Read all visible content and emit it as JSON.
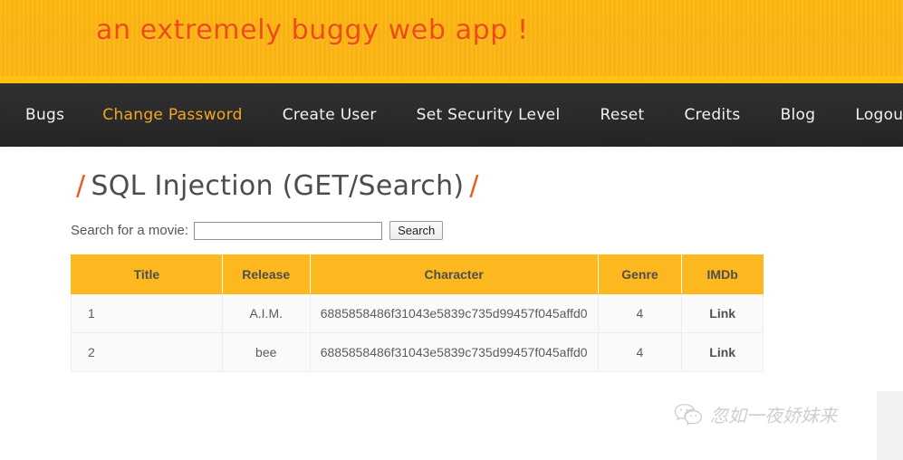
{
  "banner": {
    "tagline": "an extremely buggy web app !",
    "bg_color": "#fcb813",
    "stripe_color": "#ffc20e",
    "tagline_color": "#f04a18"
  },
  "nav": {
    "bg_color": "#2b2b2b",
    "active_color": "#f5a623",
    "items": [
      {
        "label": "Bugs",
        "active": false
      },
      {
        "label": "Change Password",
        "active": true
      },
      {
        "label": "Create User",
        "active": false
      },
      {
        "label": "Set Security Level",
        "active": false
      },
      {
        "label": "Reset",
        "active": false
      },
      {
        "label": "Credits",
        "active": false
      },
      {
        "label": "Blog",
        "active": false
      },
      {
        "label": "Logout",
        "active": false
      }
    ]
  },
  "page": {
    "title": "SQL Injection (GET/Search)",
    "title_slash": "/",
    "title_color": "#4d4d4d"
  },
  "search": {
    "label": "Search for a movie:",
    "value": "",
    "placeholder": "",
    "button_label": "Search"
  },
  "table": {
    "header_color": "#fcb81e",
    "columns": [
      "Title",
      "Release",
      "Character",
      "Genre",
      "IMDb"
    ],
    "rows": [
      {
        "title": "1",
        "release": "A.I.M.",
        "character": "6885858486f31043e5839c735d99457f045affd0",
        "genre": "4",
        "imdb": "Link"
      },
      {
        "title": "2",
        "release": "bee",
        "character": "6885858486f31043e5839c735d99457f045affd0",
        "genre": "4",
        "imdb": "Link"
      }
    ]
  },
  "watermark": {
    "text": "忽如一夜娇妹来",
    "icon": "wechat-icon"
  }
}
